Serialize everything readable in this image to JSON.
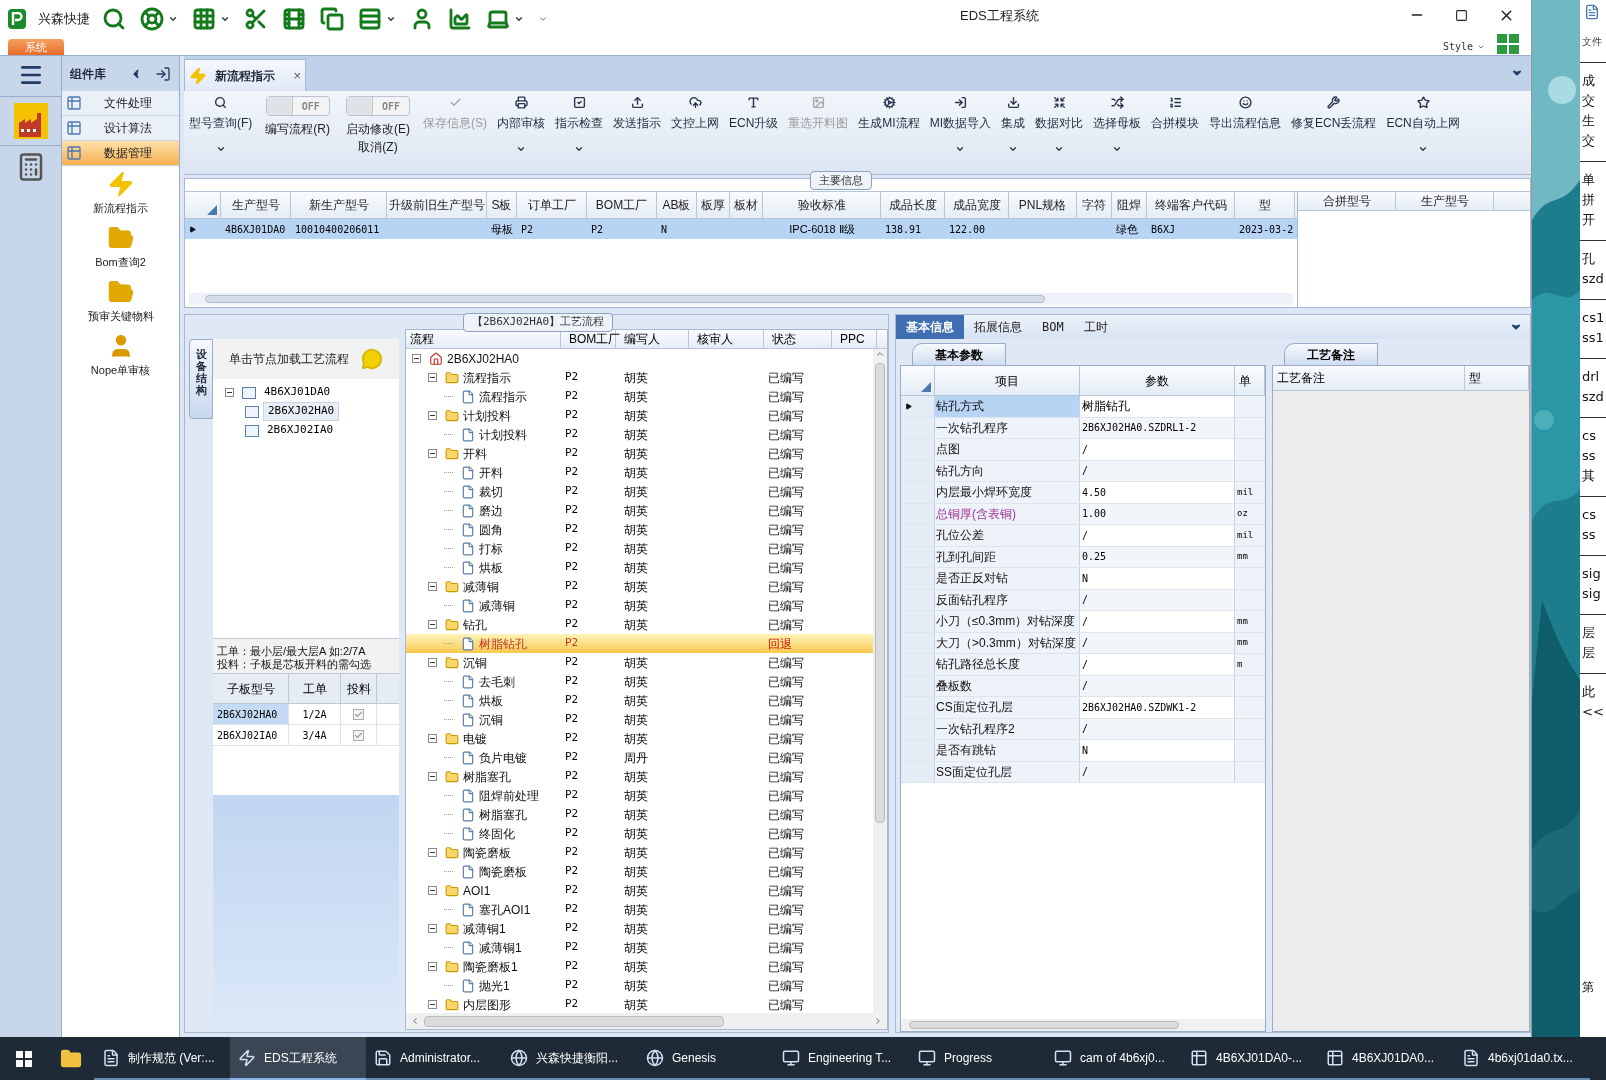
{
  "window": {
    "title": "EDS工程系统",
    "app_name": "兴森快捷",
    "system_tab": "系统",
    "style_menu": "Style"
  },
  "component_library": {
    "title": "组件库",
    "categories": [
      {
        "label": "文件处理",
        "selected": false
      },
      {
        "label": "设计算法",
        "selected": false
      },
      {
        "label": "数据管理",
        "selected": true
      }
    ],
    "tools": [
      {
        "label": "新流程指示"
      },
      {
        "label": "Bom查询2"
      },
      {
        "label": "预审关键物料"
      },
      {
        "label": "Nope单审核"
      }
    ]
  },
  "document_tab": {
    "label": "新流程指示",
    "close": "×"
  },
  "ribbon": [
    {
      "kind": "button",
      "label": "型号查询(F)",
      "disabled": false,
      "dropdown": true
    },
    {
      "kind": "toggle",
      "label": "编写流程(R)",
      "state_text": "OFF",
      "on": false
    },
    {
      "kind": "toggle",
      "label": "启动修改(E)",
      "label_2": "取消(Z)",
      "state_text": "OFF",
      "on": false
    },
    {
      "kind": "button",
      "label": "保存信息(S)",
      "disabled": true,
      "dropdown": false
    },
    {
      "kind": "button",
      "label": "内部审核",
      "disabled": false,
      "dropdown": true
    },
    {
      "kind": "button",
      "label": "指示检查",
      "disabled": false,
      "dropdown": true
    },
    {
      "kind": "button",
      "label": "发送指示",
      "disabled": false,
      "dropdown": false
    },
    {
      "kind": "button",
      "label": "文控上网",
      "disabled": false,
      "dropdown": false
    },
    {
      "kind": "button",
      "label": "ECN升级",
      "disabled": false,
      "dropdown": false
    },
    {
      "kind": "button",
      "label": "重选开料图",
      "disabled": true,
      "dropdown": false
    },
    {
      "kind": "button",
      "label": "生成MI流程",
      "disabled": false,
      "dropdown": false
    },
    {
      "kind": "button",
      "label": "MI数据导入",
      "disabled": false,
      "dropdown": true
    },
    {
      "kind": "button",
      "label": "集成",
      "disabled": false,
      "dropdown": true
    },
    {
      "kind": "button",
      "label": "数据对比",
      "disabled": false,
      "dropdown": true
    },
    {
      "kind": "button",
      "label": "选择母板",
      "disabled": false,
      "dropdown": true
    },
    {
      "kind": "button",
      "label": "合拼模块",
      "disabled": false,
      "dropdown": false
    },
    {
      "kind": "button",
      "label": "导出流程信息",
      "disabled": false,
      "dropdown": false
    },
    {
      "kind": "button",
      "label": "修复ECN丢流程",
      "disabled": false,
      "dropdown": false
    },
    {
      "kind": "button",
      "label": "ECN自动上网",
      "disabled": false,
      "dropdown": true
    }
  ],
  "main_info": {
    "title": "主要信息",
    "columns": [
      {
        "label": "生产型号",
        "value": "4B6XJ01DA0"
      },
      {
        "label": "新生产型号",
        "value": "10010400206011"
      },
      {
        "label": "升级前旧生产型号"
      },
      {
        "label": "S板",
        "value": "母板"
      },
      {
        "label": "订单工厂",
        "value": "P2"
      },
      {
        "label": "BOM工厂",
        "value": "P2"
      },
      {
        "label": "AB板",
        "value": "N"
      },
      {
        "label": "板厚"
      },
      {
        "label": "板材"
      },
      {
        "label": "验收标准",
        "value": "IPC-6018 Ⅱ级"
      },
      {
        "label": "成品长度",
        "value": "138.91"
      },
      {
        "label": "成品宽度",
        "value": "122.00"
      },
      {
        "label": "PNL规格"
      },
      {
        "label": "字符"
      },
      {
        "label": "阻焊",
        "value": "绿色"
      },
      {
        "label": "终端客户代码",
        "value": "B6XJ"
      },
      {
        "label": "型",
        "value": "2023-03-2"
      }
    ],
    "row_selected": true,
    "merge_columns": [
      "合拼型号",
      "生产型号"
    ]
  },
  "flow_panel": {
    "title": "【2B6XJ02HA0】工艺流程",
    "side_tab": "设备结构",
    "hint": "单击节点加载工艺流程",
    "boards": {
      "label": "4B6XJ01DA0",
      "expanded": true,
      "children": [
        {
          "label": "2B6XJ02HA0",
          "selected": true
        },
        {
          "label": "2B6XJ02IA0",
          "selected": false
        }
      ]
    },
    "note_lines": [
      "工单：最小层/最大层A 如:2/7A",
      "投料：子板是芯板开料的需勾选"
    ],
    "sub_table": {
      "columns": [
        "子板型号",
        "工单",
        "投料"
      ],
      "rows": [
        {
          "model": "2B6XJ02HA0",
          "order": "1/2A",
          "checked": true,
          "selected": true
        },
        {
          "model": "2B6XJ02IA0",
          "order": "3/4A",
          "checked": true,
          "selected": false
        }
      ]
    }
  },
  "flow_tree": {
    "columns": [
      "流程",
      "BOM工厂",
      "编写人",
      "核审人",
      "状态",
      "PPC"
    ],
    "root": {
      "label": "2B6XJ02HA0",
      "expanded": true,
      "children": [
        {
          "label": "流程指示",
          "bom": "P2",
          "author": "胡英",
          "status": "已编写",
          "expanded": true,
          "children": [
            {
              "label": "流程指示",
              "bom": "P2",
              "author": "胡英",
              "status": "已编写",
              "selected": false
            }
          ]
        },
        {
          "label": "计划投料",
          "bom": "P2",
          "author": "胡英",
          "status": "已编写",
          "expanded": true,
          "children": [
            {
              "label": "计划投料",
              "bom": "P2",
              "author": "胡英",
              "status": "已编写",
              "selected": false
            }
          ]
        },
        {
          "label": "开料",
          "bom": "P2",
          "author": "胡英",
          "status": "已编写",
          "expanded": true,
          "children": [
            {
              "label": "开料",
              "bom": "P2",
              "author": "胡英",
              "status": "已编写",
              "selected": false
            },
            {
              "label": "裁切",
              "bom": "P2",
              "author": "胡英",
              "status": "已编写",
              "selected": false
            },
            {
              "label": "磨边",
              "bom": "P2",
              "author": "胡英",
              "status": "已编写",
              "selected": false
            },
            {
              "label": "圆角",
              "bom": "P2",
              "author": "胡英",
              "status": "已编写",
              "selected": false
            },
            {
              "label": "打标",
              "bom": "P2",
              "author": "胡英",
              "status": "已编写",
              "selected": false
            },
            {
              "label": "烘板",
              "bom": "P2",
              "author": "胡英",
              "status": "已编写",
              "selected": false
            }
          ]
        },
        {
          "label": "减薄铜",
          "bom": "P2",
          "author": "胡英",
          "status": "已编写",
          "expanded": true,
          "children": [
            {
              "label": "减薄铜",
              "bom": "P2",
              "author": "胡英",
              "status": "已编写",
              "selected": false
            }
          ]
        },
        {
          "label": "钻孔",
          "bom": "P2",
          "author": "胡英",
          "status": "已编写",
          "expanded": true,
          "children": [
            {
              "label": "树脂钻孔",
              "bom": "P2",
              "status": "回退",
              "selected": true
            }
          ]
        },
        {
          "label": "沉铜",
          "bom": "P2",
          "author": "胡英",
          "status": "已编写",
          "expanded": true,
          "children": [
            {
              "label": "去毛刺",
              "bom": "P2",
              "author": "胡英",
              "status": "已编写",
              "selected": false
            },
            {
              "label": "烘板",
              "bom": "P2",
              "author": "胡英",
              "status": "已编写",
              "selected": false
            },
            {
              "label": "沉铜",
              "bom": "P2",
              "author": "胡英",
              "status": "已编写",
              "selected": false
            }
          ]
        },
        {
          "label": "电镀",
          "bom": "P2",
          "author": "胡英",
          "status": "已编写",
          "expanded": true,
          "children": [
            {
              "label": "负片电镀",
              "bom": "P2",
              "author": "周丹",
              "status": "已编写",
              "selected": false
            }
          ]
        },
        {
          "label": "树脂塞孔",
          "bom": "P2",
          "author": "胡英",
          "status": "已编写",
          "expanded": true,
          "children": [
            {
              "label": "阻焊前处理",
              "bom": "P2",
              "author": "胡英",
              "status": "已编写",
              "selected": false
            },
            {
              "label": "树脂塞孔",
              "bom": "P2",
              "author": "胡英",
              "status": "已编写",
              "selected": false
            },
            {
              "label": "终固化",
              "bom": "P2",
              "author": "胡英",
              "status": "已编写",
              "selected": false
            }
          ]
        },
        {
          "label": "陶瓷磨板",
          "bom": "P2",
          "author": "胡英",
          "status": "已编写",
          "expanded": true,
          "children": [
            {
              "label": "陶瓷磨板",
              "bom": "P2",
              "author": "胡英",
              "status": "已编写",
              "selected": false
            }
          ]
        },
        {
          "label": "AOI1",
          "bom": "P2",
          "author": "胡英",
          "status": "已编写",
          "expanded": true,
          "children": [
            {
              "label": "塞孔AOI1",
              "bom": "P2",
              "author": "胡英",
              "status": "已编写",
              "selected": false
            }
          ]
        },
        {
          "label": "减薄铜1",
          "bom": "P2",
          "author": "胡英",
          "status": "已编写",
          "expanded": true,
          "children": [
            {
              "label": "减薄铜1",
              "bom": "P2",
              "author": "胡英",
              "status": "已编写",
              "selected": false
            }
          ]
        },
        {
          "label": "陶瓷磨板1",
          "bom": "P2",
          "author": "胡英",
          "status": "已编写",
          "expanded": true,
          "children": [
            {
              "label": "抛光1",
              "bom": "P2",
              "author": "胡英",
              "status": "已编写",
              "selected": false
            }
          ]
        },
        {
          "label": "内层图形",
          "bom": "P2",
          "author": "胡英",
          "status": "已编写",
          "expanded": true
        }
      ]
    }
  },
  "detail_tabs": [
    {
      "label": "基本信息",
      "selected": true
    },
    {
      "label": "拓展信息",
      "selected": false
    },
    {
      "label": "BOM",
      "selected": false
    },
    {
      "label": "工时",
      "selected": false
    }
  ],
  "parameters": {
    "tab": "基本参数",
    "columns": [
      "项目",
      "参数",
      "单"
    ],
    "rows": [
      {
        "item": "钻孔方式",
        "value": "树脂钻孔",
        "selected": true,
        "flagged": false
      },
      {
        "item": "一次钻孔程序",
        "value": "2B6XJ02HA0.SZDRL1-2",
        "selected": false,
        "flagged": false
      },
      {
        "item": "点图",
        "value": "/",
        "selected": false,
        "flagged": false
      },
      {
        "item": "钻孔方向",
        "value": "/",
        "selected": false,
        "flagged": false
      },
      {
        "item": "内层最小焊环宽度",
        "value": "4.50",
        "unit": "mil",
        "selected": false,
        "flagged": false
      },
      {
        "item": "总铜厚(含表铜)",
        "value": "1.00",
        "unit": "oz",
        "selected": false,
        "flagged": true
      },
      {
        "item": "孔位公差",
        "value": "/",
        "unit": "mil",
        "selected": false,
        "flagged": false
      },
      {
        "item": "孔到孔间距",
        "value": "0.25",
        "unit": "mm",
        "selected": false,
        "flagged": false
      },
      {
        "item": "是否正反对钻",
        "value": "N",
        "selected": false,
        "flagged": false
      },
      {
        "item": "反面钻孔程序",
        "value": "/",
        "selected": false,
        "flagged": false
      },
      {
        "item": "小刀（≤0.3mm）对钻深度",
        "value": "/",
        "unit": "mm",
        "selected": false,
        "flagged": false
      },
      {
        "item": "大刀（>0.3mm）对钻深度",
        "value": "/",
        "unit": "mm",
        "selected": false,
        "flagged": false
      },
      {
        "item": "钻孔路径总长度",
        "value": "/",
        "unit": "m",
        "selected": false,
        "flagged": false
      },
      {
        "item": "叠板数",
        "value": "/",
        "selected": false,
        "flagged": false
      },
      {
        "item": "CS面定位孔层",
        "value": "2B6XJ02HA0.SZDWK1-2",
        "selected": false,
        "flagged": false
      },
      {
        "item": "一次钻孔程序2",
        "value": "/",
        "selected": false,
        "flagged": false
      },
      {
        "item": "是否有跳钻",
        "value": "N",
        "selected": false,
        "flagged": false
      },
      {
        "item": "SS面定位孔层",
        "value": "/",
        "selected": false,
        "flagged": false
      }
    ]
  },
  "process_notes": {
    "tab": "工艺备注",
    "columns": [
      "工艺备注",
      "型"
    ]
  },
  "notepad": {
    "menu": "文件",
    "lines": [
      [
        "成",
        "交",
        "生",
        "交"
      ],
      [
        "单",
        "拼",
        "开"
      ],
      [
        "孔",
        "szd"
      ],
      [
        "cs1",
        "ss1"
      ],
      [
        "drl",
        "szd"
      ],
      [
        "cs",
        "ss",
        "其"
      ],
      [
        "cs",
        "ss"
      ],
      [
        "sig",
        "sig"
      ],
      [
        "层",
        "层"
      ],
      [
        "此",
        "<<"
      ]
    ],
    "footer": "第"
  },
  "taskbar": [
    {
      "label": "制作规范 (Ver:...",
      "active": false
    },
    {
      "label": "EDS工程系统",
      "active": true
    },
    {
      "label": "Administrator...",
      "active": false
    },
    {
      "label": "兴森快捷衡阳...",
      "active": false
    },
    {
      "label": "Genesis",
      "active": false
    },
    {
      "label": "Engineering T...",
      "active": false
    },
    {
      "label": "Progress",
      "active": false
    },
    {
      "label": "cam of 4b6xj0...",
      "active": false
    },
    {
      "label": "4B6XJ01DA0-...",
      "active": false
    },
    {
      "label": "4B6XJ01DA0...",
      "active": false
    },
    {
      "label": "4b6xj01da0.tx...",
      "active": false
    }
  ]
}
